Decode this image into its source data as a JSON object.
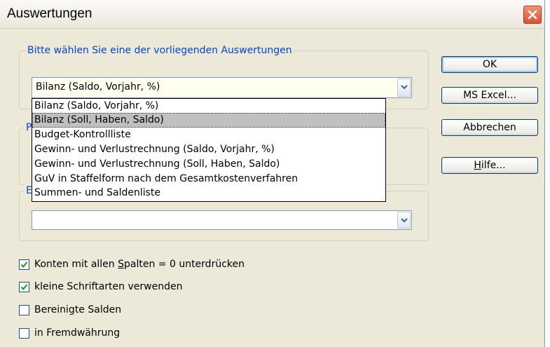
{
  "window": {
    "title": "Auswertungen",
    "close_icon": "close-icon"
  },
  "group1": {
    "label": "Bitte wählen Sie eine der vorliegenden Auswertungen",
    "combo_value": "Bilanz (Saldo, Vorjahr, %)",
    "options": [
      "Bilanz (Saldo, Vorjahr, %)",
      "Bilanz (Soll, Haben, Saldo)",
      "Budget-Kontrollliste",
      "Gewinn- und Verlustrechnung (Saldo, Vorjahr, %)",
      "Gewinn- und Verlustrechnung (Soll, Haben, Saldo)",
      "GuV in Staffelform nach dem Gesamtkostenverfahren",
      "Summen- und Saldenliste"
    ],
    "selected_option": "Bilanz (Soll, Haben, Saldo)"
  },
  "group2": {
    "label_visible": "P"
  },
  "group3": {
    "label_visible": "E",
    "combo_value": ""
  },
  "buttons": {
    "ok": "OK",
    "excel": "MS Excel...",
    "cancel": "Abbrechen",
    "help_prefix": "H",
    "help_rest": "ilfe..."
  },
  "checkboxes": [
    {
      "pre": "Konten mit allen ",
      "key": "S",
      "post": "palten = 0 unterdrücken",
      "checked": true
    },
    {
      "pre": "kleine Schriftarten verwenden",
      "key": "",
      "post": "",
      "checked": true
    },
    {
      "pre": "Bereinigte Salden",
      "key": "",
      "post": "",
      "checked": false
    },
    {
      "pre": "in Fremdwährung",
      "key": "",
      "post": "",
      "checked": false
    }
  ],
  "colors": {
    "group_label": "#0046d5",
    "dialog_bg": "#ece9d8",
    "close_red": "#d9532f"
  }
}
